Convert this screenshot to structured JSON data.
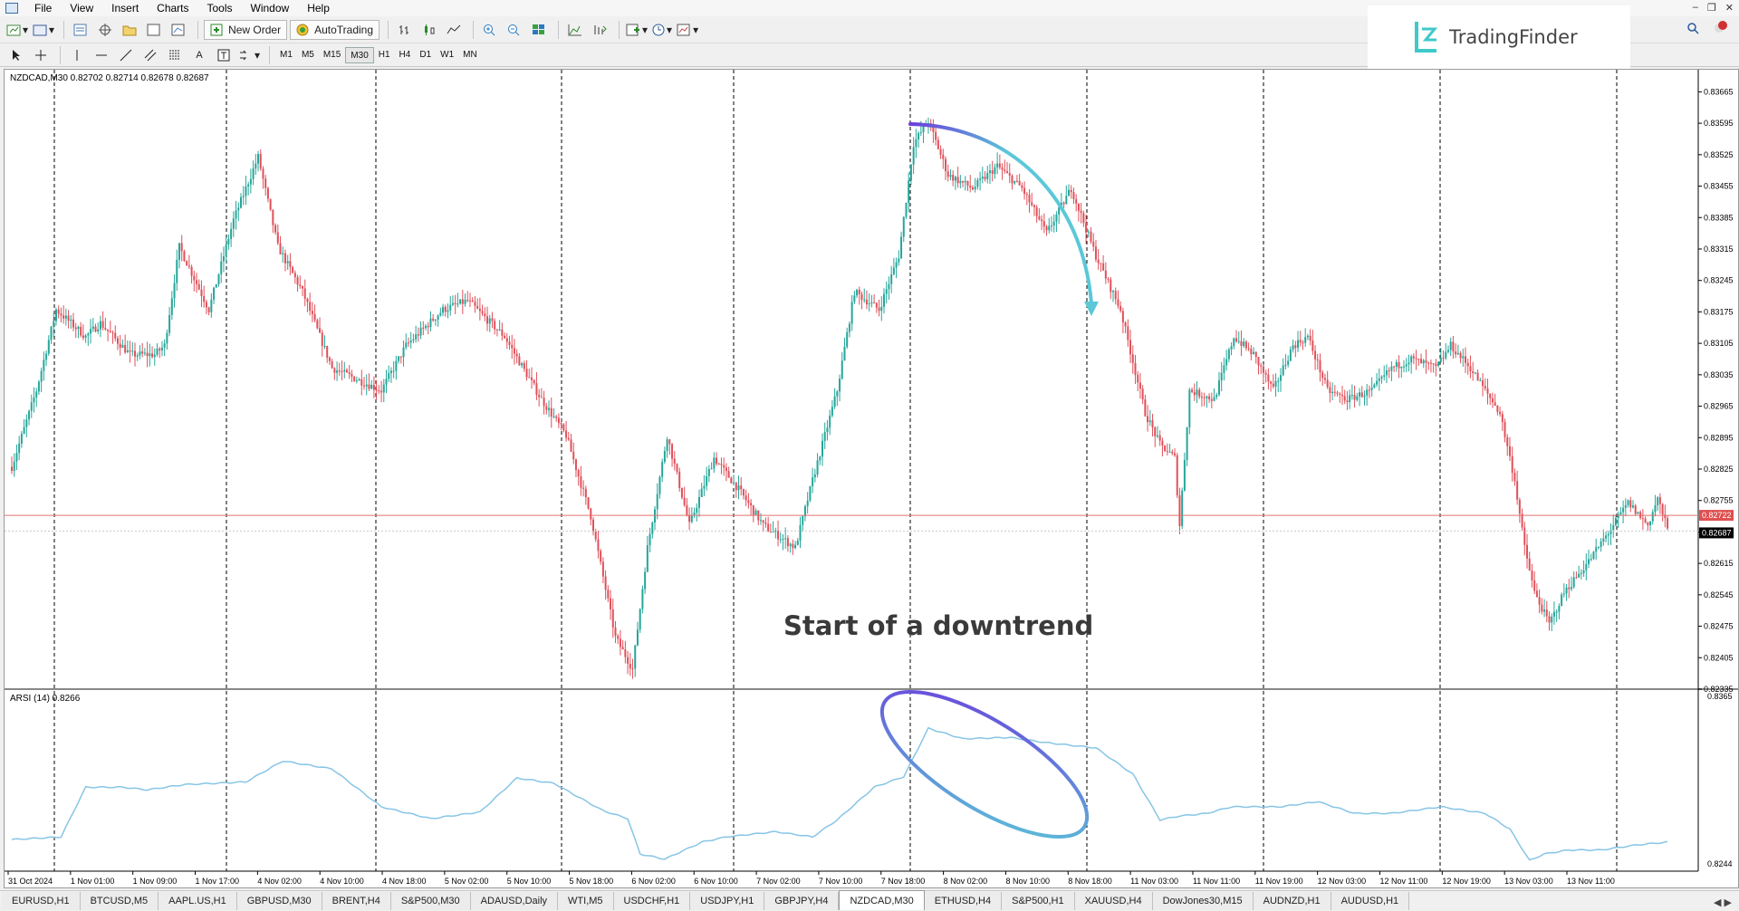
{
  "menu": [
    "File",
    "View",
    "Insert",
    "Charts",
    "Tools",
    "Window",
    "Help"
  ],
  "toolbar": {
    "new_order": "New Order",
    "auto_trading": "AutoTrading"
  },
  "timeframes": [
    "M1",
    "M5",
    "M15",
    "M30",
    "H1",
    "H4",
    "D1",
    "W1",
    "MN"
  ],
  "active_timeframe": "M30",
  "logo": {
    "text": "TradingFinder"
  },
  "chart": {
    "symbol_line": "NZDCAD,M30  0.82702 0.82714 0.82678 0.82687",
    "indicator_label": "ARSI (14) 0.8266",
    "annotation": "Start of a downtrend",
    "current_price_label": "0.82687",
    "ask_price_label": "0.82722",
    "sub_top_label": "0.8365",
    "sub_bottom_label": "0.8244",
    "colors": {
      "bull": "#26a69a",
      "bear": "#e0505a",
      "indicator": "#87c5e6",
      "price_line": "#e07070",
      "arrow": "#5bc8d8",
      "ellipse_start": "#6a3fdc",
      "ellipse_end": "#5bc8d8"
    }
  },
  "chart_data": {
    "type": "candlestick",
    "symbol": "NZDCAD",
    "timeframe": "M30",
    "y_ticks": [
      "0.83665",
      "0.83595",
      "0.83525",
      "0.83455",
      "0.83385",
      "0.83315",
      "0.83245",
      "0.83175",
      "0.83105",
      "0.83035",
      "0.82965",
      "0.82895",
      "0.82825",
      "0.82755",
      "0.82685",
      "0.82615",
      "0.82545",
      "0.82475",
      "0.82405",
      "0.82335"
    ],
    "x_ticks": [
      "31 Oct 2024",
      "1 Nov 01:00",
      "1 Nov 09:00",
      "1 Nov 17:00",
      "4 Nov 02:00",
      "4 Nov 10:00",
      "4 Nov 18:00",
      "5 Nov 02:00",
      "5 Nov 10:00",
      "5 Nov 18:00",
      "6 Nov 02:00",
      "6 Nov 10:00",
      "7 Nov 02:00",
      "7 Nov 10:00",
      "7 Nov 18:00",
      "8 Nov 02:00",
      "8 Nov 10:00",
      "8 Nov 18:00",
      "11 Nov 03:00",
      "11 Nov 11:00",
      "11 Nov 19:00",
      "12 Nov 03:00",
      "12 Nov 11:00",
      "12 Nov 19:00",
      "13 Nov 03:00",
      "13 Nov 11:00"
    ],
    "ylim": [
      0.82335,
      0.8369
    ],
    "close_anchors": [
      [
        0,
        0.8283
      ],
      [
        10,
        0.83
      ],
      [
        18,
        0.8318
      ],
      [
        30,
        0.8312
      ],
      [
        36,
        0.8315
      ],
      [
        48,
        0.8308
      ],
      [
        58,
        0.8308
      ],
      [
        62,
        0.831
      ],
      [
        68,
        0.8332
      ],
      [
        80,
        0.8318
      ],
      [
        90,
        0.8338
      ],
      [
        100,
        0.8352
      ],
      [
        108,
        0.8332
      ],
      [
        118,
        0.8322
      ],
      [
        130,
        0.8305
      ],
      [
        150,
        0.83
      ],
      [
        160,
        0.831
      ],
      [
        175,
        0.8318
      ],
      [
        185,
        0.832
      ],
      [
        200,
        0.8312
      ],
      [
        215,
        0.8298
      ],
      [
        225,
        0.829
      ],
      [
        235,
        0.8272
      ],
      [
        245,
        0.8245
      ],
      [
        252,
        0.8238
      ],
      [
        258,
        0.8265
      ],
      [
        266,
        0.829
      ],
      [
        275,
        0.827
      ],
      [
        285,
        0.8285
      ],
      [
        295,
        0.8278
      ],
      [
        305,
        0.827
      ],
      [
        318,
        0.8265
      ],
      [
        325,
        0.828
      ],
      [
        335,
        0.83
      ],
      [
        342,
        0.8322
      ],
      [
        352,
        0.8318
      ],
      [
        360,
        0.833
      ],
      [
        366,
        0.8355
      ],
      [
        372,
        0.836
      ],
      [
        380,
        0.8348
      ],
      [
        390,
        0.8345
      ],
      [
        400,
        0.835
      ],
      [
        410,
        0.8345
      ],
      [
        420,
        0.8335
      ],
      [
        430,
        0.8345
      ],
      [
        440,
        0.833
      ],
      [
        450,
        0.8318
      ],
      [
        460,
        0.8295
      ],
      [
        466,
        0.8288
      ],
      [
        472,
        0.8285
      ],
      [
        474,
        0.827
      ],
      [
        478,
        0.83
      ],
      [
        488,
        0.8298
      ],
      [
        496,
        0.8312
      ],
      [
        504,
        0.8308
      ],
      [
        512,
        0.83
      ],
      [
        520,
        0.831
      ],
      [
        526,
        0.8312
      ],
      [
        534,
        0.83
      ],
      [
        542,
        0.8298
      ],
      [
        552,
        0.83
      ],
      [
        560,
        0.8305
      ],
      [
        568,
        0.8307
      ],
      [
        578,
        0.8305
      ],
      [
        584,
        0.831
      ],
      [
        592,
        0.8305
      ],
      [
        598,
        0.83
      ],
      [
        604,
        0.8295
      ],
      [
        610,
        0.828
      ],
      [
        614,
        0.8265
      ],
      [
        618,
        0.8255
      ],
      [
        624,
        0.8248
      ],
      [
        630,
        0.8255
      ],
      [
        640,
        0.8262
      ],
      [
        650,
        0.827
      ],
      [
        656,
        0.8275
      ],
      [
        664,
        0.827
      ],
      [
        668,
        0.8276
      ],
      [
        672,
        0.8269
      ]
    ],
    "indicator": {
      "name": "ARSI (14)",
      "last_value": 0.8266,
      "anchors": [
        [
          0,
          0.826
        ],
        [
          20,
          0.8262
        ],
        [
          30,
          0.83
        ],
        [
          45,
          0.83
        ],
        [
          55,
          0.8298
        ],
        [
          70,
          0.8302
        ],
        [
          95,
          0.8304
        ],
        [
          110,
          0.832
        ],
        [
          130,
          0.8314
        ],
        [
          150,
          0.8285
        ],
        [
          170,
          0.8276
        ],
        [
          190,
          0.8281
        ],
        [
          205,
          0.8307
        ],
        [
          220,
          0.8303
        ],
        [
          240,
          0.8282
        ],
        [
          250,
          0.8276
        ],
        [
          255,
          0.8249
        ],
        [
          265,
          0.8245
        ],
        [
          280,
          0.8258
        ],
        [
          290,
          0.8262
        ],
        [
          310,
          0.8266
        ],
        [
          325,
          0.8262
        ],
        [
          335,
          0.8275
        ],
        [
          350,
          0.83
        ],
        [
          362,
          0.8308
        ],
        [
          372,
          0.8345
        ],
        [
          386,
          0.8337
        ],
        [
          405,
          0.8338
        ],
        [
          420,
          0.8334
        ],
        [
          440,
          0.833
        ],
        [
          455,
          0.831
        ],
        [
          466,
          0.8275
        ],
        [
          474,
          0.8278
        ],
        [
          485,
          0.828
        ],
        [
          495,
          0.8285
        ],
        [
          515,
          0.8285
        ],
        [
          530,
          0.8289
        ],
        [
          545,
          0.828
        ],
        [
          560,
          0.828
        ],
        [
          580,
          0.8285
        ],
        [
          598,
          0.828
        ],
        [
          608,
          0.8268
        ],
        [
          616,
          0.8244
        ],
        [
          622,
          0.8249
        ],
        [
          632,
          0.8252
        ],
        [
          645,
          0.8252
        ],
        [
          660,
          0.8256
        ],
        [
          672,
          0.8258
        ]
      ]
    }
  },
  "tabs": [
    "EURUSD,H1",
    "BTCUSD,M5",
    "AAPL.US,H1",
    "GBPUSD,M30",
    "BRENT,H4",
    "S&P500,M30",
    "ADAUSD,Daily",
    "WTI,M5",
    "USDCHF,H1",
    "USDJPY,H1",
    "GBPJPY,H4",
    "NZDCAD,M30",
    "ETHUSD,H4",
    "S&P500,H1",
    "XAUUSD,H4",
    "DowJones30,M15",
    "AUDNZD,H1",
    "AUDUSD,H1"
  ],
  "active_tab": "NZDCAD,M30"
}
